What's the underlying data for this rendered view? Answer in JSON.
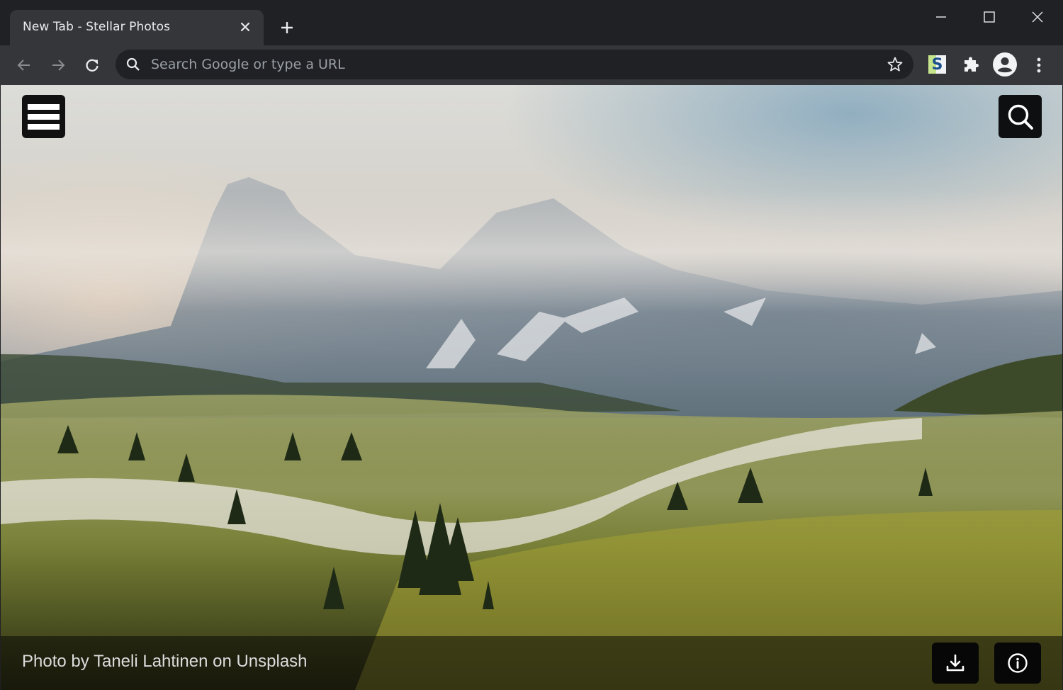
{
  "browser": {
    "tab": {
      "title": "New Tab - Stellar Photos",
      "close_icon": "close-icon"
    },
    "new_tab_icon": "plus-icon",
    "window_controls": [
      "minimize-icon",
      "maximize-icon",
      "close-icon"
    ],
    "omnibox": {
      "placeholder": "Search Google or type a URL",
      "value": ""
    },
    "extensions": {
      "s_extension_label": "S"
    }
  },
  "page": {
    "menu_icon": "hamburger-icon",
    "search_icon": "search-icon",
    "photo_credit": "Photo by Taneli Lahtinen on Unsplash",
    "actions": [
      {
        "name": "download",
        "icon": "download-icon"
      },
      {
        "name": "info",
        "icon": "info-icon"
      }
    ]
  }
}
